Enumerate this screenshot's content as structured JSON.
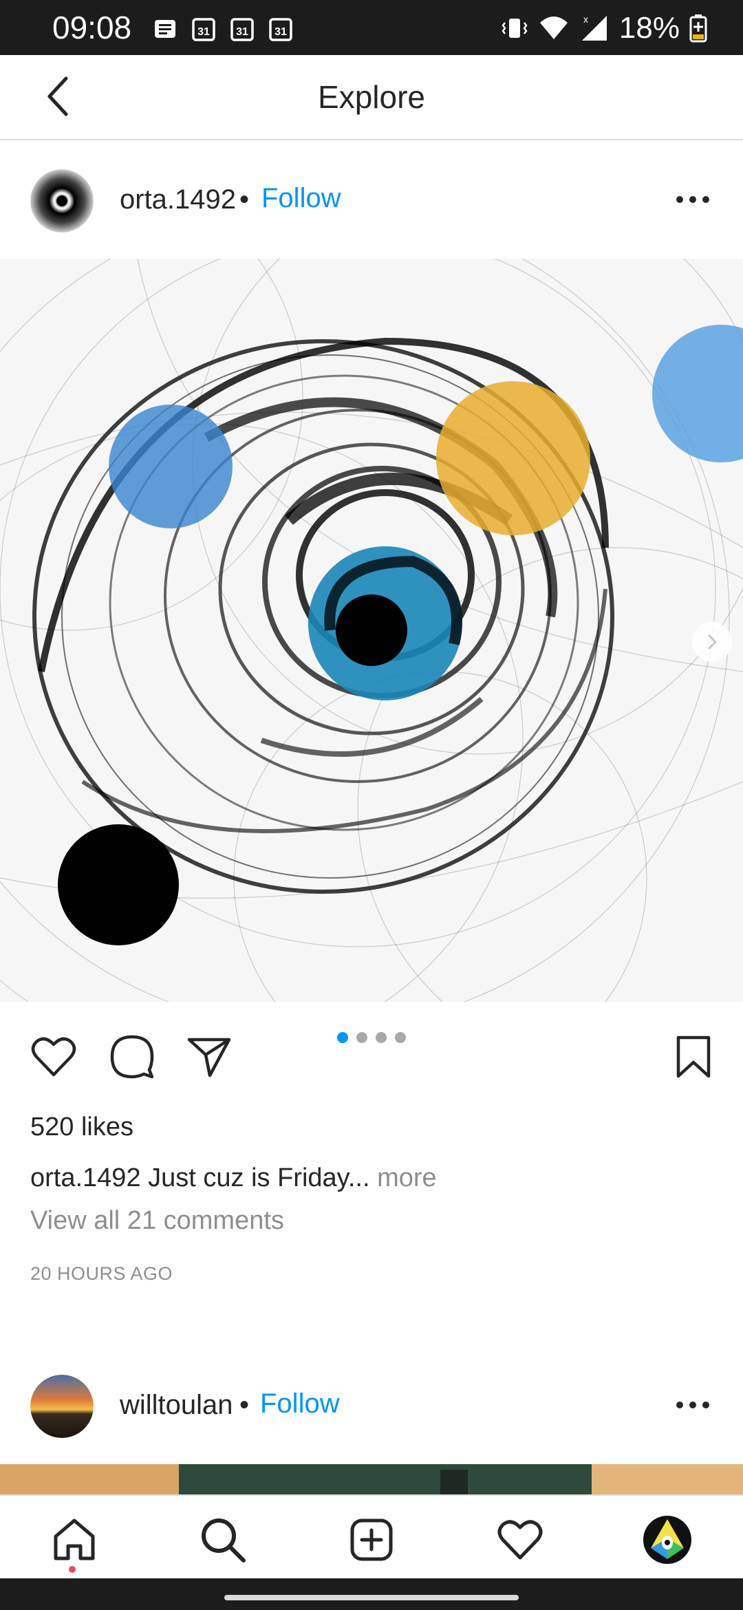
{
  "status_bar": {
    "time": "09:08",
    "notifications": [
      "message-icon",
      "calendar-icon",
      "calendar-icon",
      "calendar-icon"
    ],
    "calendar_day": "31",
    "battery": "18%",
    "signal_badge": "x"
  },
  "header": {
    "title": "Explore"
  },
  "post": {
    "username": "orta.1492",
    "separator": "•",
    "follow_label": "Follow",
    "carousel_count": 4,
    "carousel_active": 0,
    "likes": "520 likes",
    "caption_user": "orta.1492",
    "caption_text": "Just cuz is Friday...",
    "caption_more": "more",
    "view_comments": "View all 21 comments",
    "timestamp": "20 HOURS AGO"
  },
  "next_post": {
    "username": "willtoulan",
    "separator": "•",
    "follow_label": "Follow"
  },
  "colors": {
    "accent": "#0095f6",
    "text": "#262626",
    "muted": "#8e8e8e",
    "status_bar": "#1c1c1c"
  }
}
